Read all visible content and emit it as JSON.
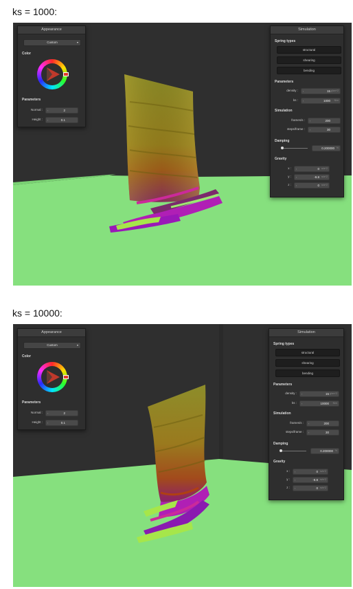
{
  "screens": [
    {
      "caption": "ks = 1000:",
      "appearance": {
        "title": "Appearance",
        "preset": "Custom",
        "color_label": "Color",
        "parameters_label": "Parameters",
        "normal_label": "Normal :",
        "normal_value": "2",
        "height_label": "Height :",
        "height_value": "0.1"
      },
      "simulation": {
        "title": "Simulation",
        "spring_types_label": "Spring types",
        "spring_buttons": [
          "structural",
          "shearing",
          "bending"
        ],
        "parameters_label": "Parameters",
        "density_label": "density :",
        "density_value": "15",
        "density_unit": "g/cm^2",
        "ks_label": "ks :",
        "ks_value": "1000",
        "ks_unit": "N/m",
        "simulation_label": "Simulation",
        "fps_label": "frames/s :",
        "fps_value": "200",
        "steps_label": "steps/frame :",
        "steps_value": "30",
        "damping_label": "Damping",
        "damping_value": "0.200000",
        "damping_unit": "%",
        "damping_fraction": 0.02,
        "gravity_label": "Gravity",
        "gx_label": "x :",
        "gx_value": "0",
        "gy_label": "y :",
        "gy_value": "-9.8",
        "gz_label": "z :",
        "gz_value": "0",
        "gravity_unit": "m/s^2"
      }
    },
    {
      "caption": "ks = 10000:",
      "appearance": {
        "title": "Appearance",
        "preset": "Custom",
        "color_label": "Color",
        "parameters_label": "Parameters",
        "normal_label": "Normal :",
        "normal_value": "2",
        "height_label": "Height :",
        "height_value": "0.1"
      },
      "simulation": {
        "title": "Simulation",
        "spring_types_label": "Spring types",
        "spring_buttons": [
          "structural",
          "shearing",
          "bending"
        ],
        "parameters_label": "Parameters",
        "density_label": "density :",
        "density_value": "15",
        "density_unit": "g/cm^2",
        "ks_label": "ks :",
        "ks_value": "10000",
        "ks_unit": "N/m",
        "simulation_label": "Simulation",
        "fps_label": "frames/s :",
        "fps_value": "200",
        "steps_label": "steps/frame :",
        "steps_value": "30",
        "damping_label": "Damping",
        "damping_value": "0.200000",
        "damping_unit": "%",
        "damping_fraction": 0.02,
        "gravity_label": "Gravity",
        "gx_label": "x :",
        "gx_value": "0",
        "gy_label": "y :",
        "gy_value": "-9.8",
        "gz_label": "z :",
        "gz_value": "0",
        "gravity_unit": "m/s^2"
      }
    }
  ],
  "colors": {
    "wall": "#2f2f2f",
    "floor": "#86e07e",
    "panel_bg": "#2e2e2e",
    "accent_marker": "#e03a2a"
  }
}
